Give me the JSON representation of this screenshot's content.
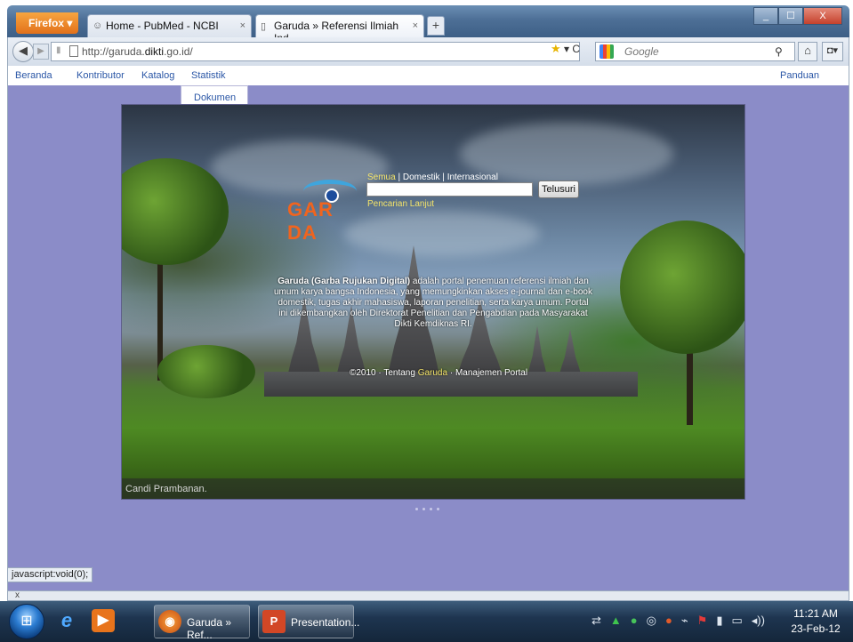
{
  "browser": {
    "menu_label": "Firefox",
    "tabs": [
      {
        "label": "Home - PubMed - NCBI"
      },
      {
        "label": "Garuda » Referensi Ilmiah Ind..."
      }
    ],
    "new_tab": "+",
    "url_prefix": "http://garuda.",
    "url_host": "dikti",
    "url_suffix": ".go.id/",
    "search_placeholder": "Google",
    "window_buttons": {
      "minimize": "_",
      "maximize": "☐",
      "close": "X"
    }
  },
  "site": {
    "nav": {
      "beranda": "Beranda",
      "kontributor": "Kontributor",
      "katalog": "Katalog",
      "statistik": "Statistik",
      "panduan": "Panduan",
      "dropdown_item": "Dokumen"
    },
    "search": {
      "filter_all": "Semua",
      "filter_domestic": "Domestik",
      "filter_international": "Internasional",
      "button": "Telusuri",
      "advanced": "Pencarian Lanjut"
    },
    "logo_text": "GAR  DA",
    "about_bold": "Garuda (Garba Rujukan Digital)",
    "about_text": " adalah portal penemuan referensi ilmiah dan umum karya bangsa Indonesia, yang memungkinkan akses e-journal dan e-book domestik, tugas akhir mahasiswa, laporan penelitian, serta karya umum. Portal ini dikembangkan oleh Direktorat Penelitian dan Pengabdian pada Masyarakat Dikti Kemdiknas RI.",
    "footer": {
      "copyright": "©2010 · Tentang ",
      "garuda": "Garuda",
      "sep": " · ",
      "manage": "Manajemen Portal"
    },
    "caption": "Candi Prambanan."
  },
  "status_bar": "javascript:void(0);",
  "addon_bar_close": "x",
  "taskbar": {
    "tasks": [
      {
        "label": "Garuda » Ref..."
      },
      {
        "label": "Presentation..."
      }
    ],
    "time": "11:21 AM",
    "date": "23-Feb-12"
  }
}
